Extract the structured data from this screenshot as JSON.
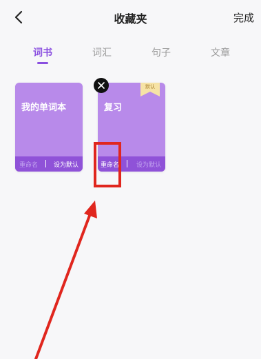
{
  "header": {
    "back_icon": "chevron-left-icon",
    "title": "收藏夹",
    "done_label": "完成"
  },
  "tabs": [
    {
      "label": "词书",
      "active": true
    },
    {
      "label": "词汇",
      "active": false
    },
    {
      "label": "句子",
      "active": false
    },
    {
      "label": "文章",
      "active": false
    }
  ],
  "cards": [
    {
      "name": "我的单词本",
      "rename_label": "重命名",
      "default_label": "设为默认",
      "is_default": false
    },
    {
      "name": "复习",
      "rename_label": "重命名",
      "default_label": "设为默认",
      "is_default": true,
      "badge": "默认"
    }
  ],
  "colors": {
    "accent": "#8a4fe0",
    "card_bg": "#b88aea",
    "card_footer": "#8f52d8",
    "annotation_red": "#e0261e",
    "default_ribbon": "#f6e3a6"
  }
}
